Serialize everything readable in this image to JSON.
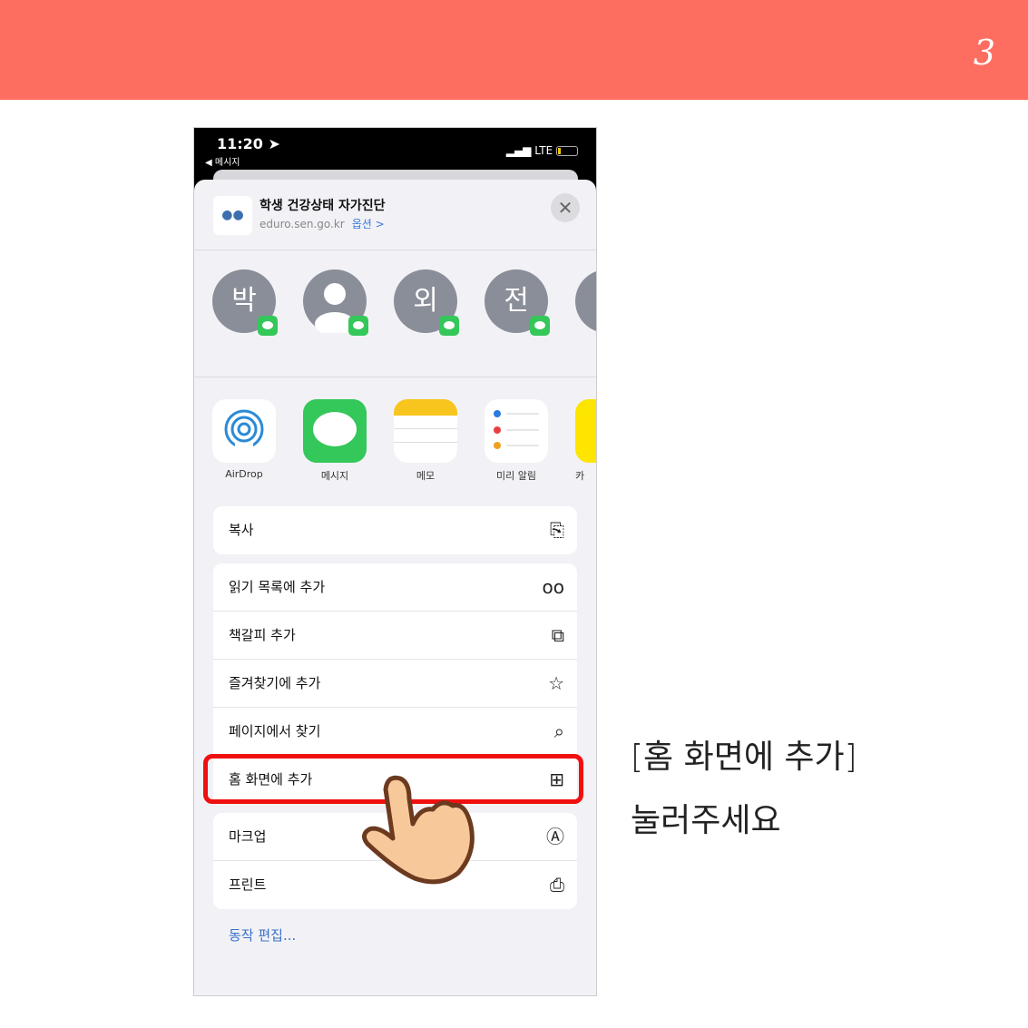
{
  "page_number": "3",
  "status": {
    "time": "11:20",
    "back": "◀ 메시지",
    "network": "LTE"
  },
  "share": {
    "title": "학생 건강상태 자가진단",
    "url": "eduro.sen.go.kr",
    "options": "옵션 >",
    "close": "✕"
  },
  "contacts": [
    "박",
    "",
    "외",
    "전"
  ],
  "apps": [
    {
      "label": "AirDrop"
    },
    {
      "label": "메시지"
    },
    {
      "label": "메모"
    },
    {
      "label": "미리 알림"
    },
    {
      "label": "카"
    }
  ],
  "actions": [
    [
      {
        "label": "복사",
        "icon": "copy-icon",
        "glyph": "⎘"
      }
    ],
    [
      {
        "label": "읽기 목록에 추가",
        "icon": "glasses-icon",
        "glyph": "oo"
      },
      {
        "label": "책갈피 추가",
        "icon": "book-icon",
        "glyph": "📖"
      },
      {
        "label": "즐겨찾기에 추가",
        "icon": "star-icon",
        "glyph": "☆"
      },
      {
        "label": "페이지에서 찾기",
        "icon": "search-icon",
        "glyph": "⌕"
      },
      {
        "label": "홈 화면에 추가",
        "icon": "add-square-icon",
        "glyph": "⊞"
      }
    ],
    [
      {
        "label": "마크업",
        "icon": "markup-icon",
        "glyph": "Ⓐ"
      },
      {
        "label": "프린트",
        "icon": "printer-icon",
        "glyph": "⎙"
      }
    ]
  ],
  "edit_actions": "동작 편집...",
  "instruction": {
    "line1": "[홈 화면에 추가]",
    "line2": "눌러주세요"
  },
  "colors": {
    "band": "#fe6e60",
    "highlight": "#f01010",
    "link": "#3b6fc9"
  }
}
